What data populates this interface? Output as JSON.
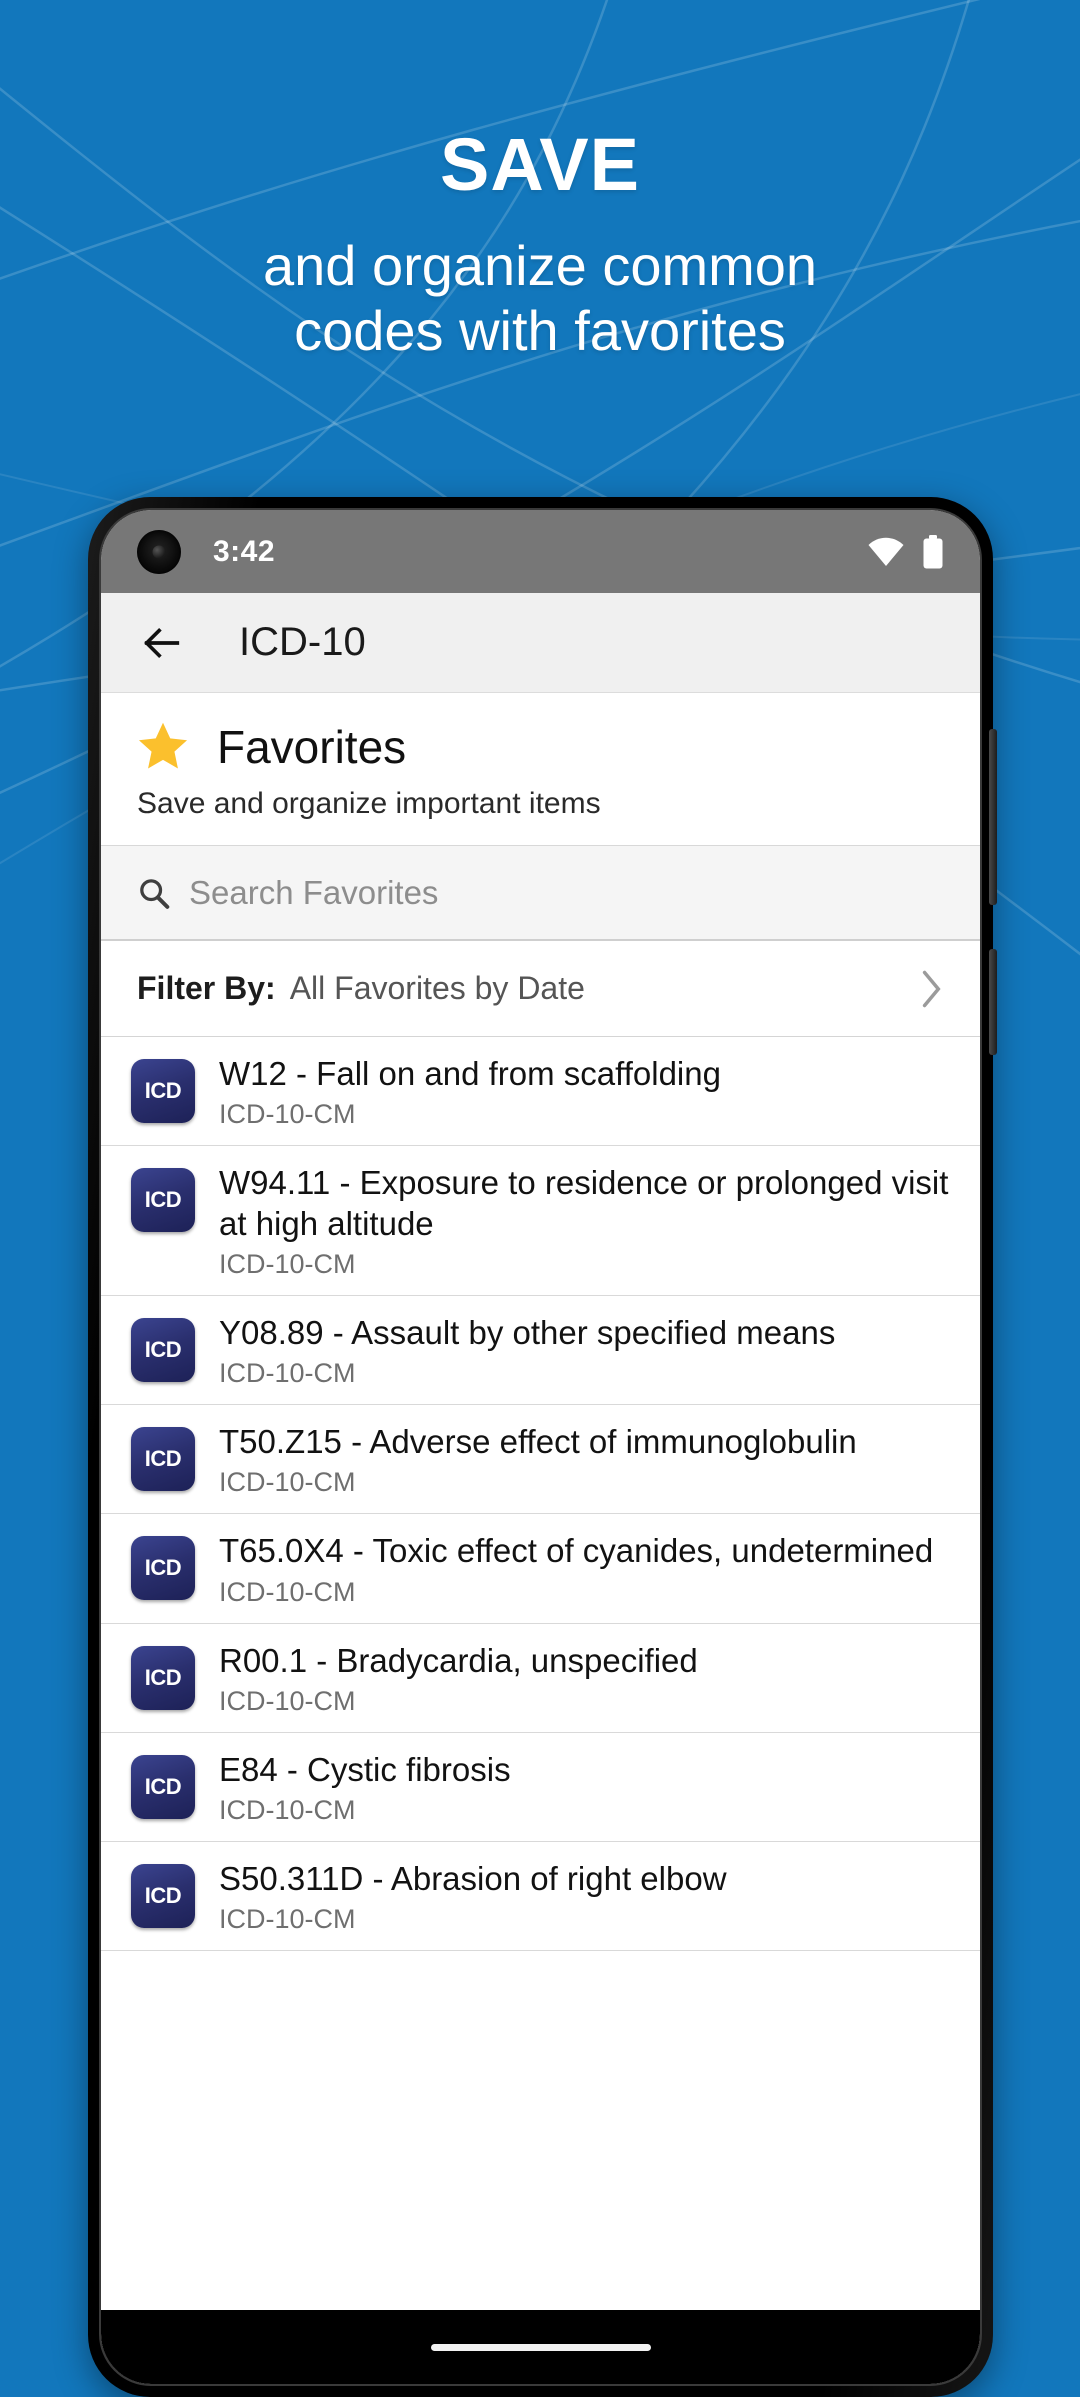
{
  "promo": {
    "title": "SAVE",
    "subtitle_line1": "and organize common",
    "subtitle_line2": "codes with favorites",
    "background_color": "#1277bc",
    "text_color": "#ffffff"
  },
  "status_bar": {
    "time": "3:42",
    "wifi_icon": "wifi-icon",
    "battery_icon": "battery-full-icon",
    "background_color": "#777777"
  },
  "app_bar": {
    "back_icon": "back-arrow-icon",
    "title": "ICD-10",
    "background_color": "#f0f0f0"
  },
  "favorites_header": {
    "star_icon": "star-icon",
    "star_color": "#fbc02d",
    "title": "Favorites",
    "subtitle": "Save and organize important items"
  },
  "search": {
    "icon": "search-icon",
    "placeholder": "Search Favorites",
    "value": ""
  },
  "filter": {
    "label": "Filter By:",
    "value": "All Favorites by Date",
    "chevron_icon": "chevron-right-icon"
  },
  "list": {
    "badge_label": "ICD",
    "badge_color": "#2a2f6e",
    "items": [
      {
        "title": "W12 - Fall on and from scaffolding",
        "subtitle": "ICD-10-CM"
      },
      {
        "title": "W94.11 - Exposure to residence or prolonged visit at high altitude",
        "subtitle": "ICD-10-CM"
      },
      {
        "title": "Y08.89 - Assault by other specified means",
        "subtitle": "ICD-10-CM"
      },
      {
        "title": "T50.Z15 - Adverse effect of immunoglobulin",
        "subtitle": "ICD-10-CM"
      },
      {
        "title": "T65.0X4 - Toxic effect of cyanides, undetermined",
        "subtitle": "ICD-10-CM"
      },
      {
        "title": "R00.1 - Bradycardia, unspecified",
        "subtitle": "ICD-10-CM"
      },
      {
        "title": "E84 - Cystic fibrosis",
        "subtitle": "ICD-10-CM"
      },
      {
        "title": "S50.311D - Abrasion of right elbow",
        "subtitle": "ICD-10-CM"
      }
    ]
  }
}
